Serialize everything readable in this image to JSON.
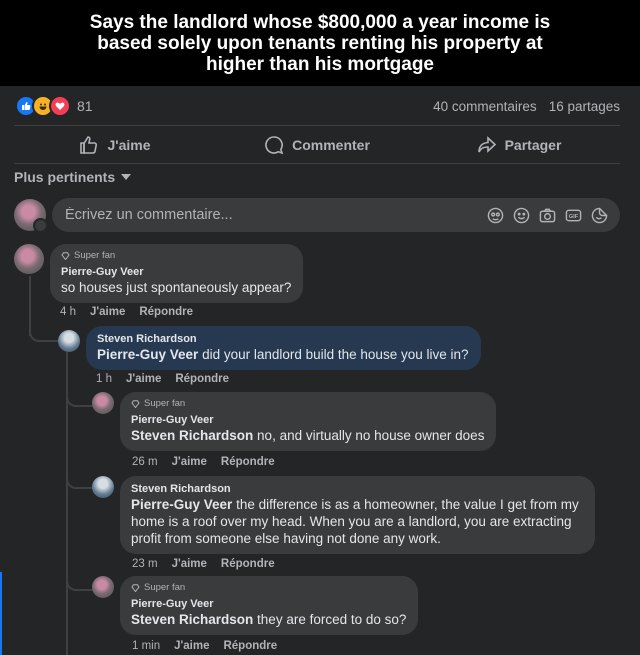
{
  "post": {
    "image_caption": "Says the landlord whose $800,000 a year income is based solely upon tenants renting his property at higher than his mortgage"
  },
  "stats": {
    "reactions_count": "81",
    "comments": "40 commentaires",
    "shares": "16 partages",
    "reaction_icons": [
      "like-icon",
      "haha-icon",
      "love-icon"
    ]
  },
  "actions": {
    "like": "J'aime",
    "comment": "Commenter",
    "share": "Partager"
  },
  "sort": {
    "label": "Plus pertinents"
  },
  "composer": {
    "placeholder": "Écrivez un commentaire...",
    "tools": [
      "sticker-avatar-icon",
      "emoji-icon",
      "camera-icon",
      "gif-icon",
      "sticker-icon"
    ]
  },
  "comments": [
    {
      "badge": "Super fan",
      "author": "Pierre-Guy Veer",
      "mention": "",
      "text": "so houses just spontaneously appear?",
      "time": "4 h",
      "like": "J'aime",
      "reply": "Répondre"
    },
    {
      "badge": "",
      "author": "Steven Richardson",
      "mention": "Pierre-Guy Veer",
      "text": " did your landlord build the house you live in?",
      "time": "1 h",
      "like": "J'aime",
      "reply": "Répondre"
    },
    {
      "badge": "Super fan",
      "author": "Pierre-Guy Veer",
      "mention": "Steven Richardson",
      "text": " no, and virtually no house owner does",
      "time": "26 m",
      "like": "J'aime",
      "reply": "Répondre"
    },
    {
      "badge": "",
      "author": "Steven Richardson",
      "mention": "Pierre-Guy Veer",
      "text": " the difference is as a homeowner, the value I get from my home is a roof over my head. When you are a landlord, you are extracting profit from someone else having not done any work.",
      "time": "23 m",
      "like": "J'aime",
      "reply": "Répondre"
    },
    {
      "badge": "Super fan",
      "author": "Pierre-Guy Veer",
      "mention": "Steven Richardson",
      "text": " they are forced to do so?",
      "time": "1 min",
      "like": "J'aime",
      "reply": "Répondre"
    }
  ]
}
